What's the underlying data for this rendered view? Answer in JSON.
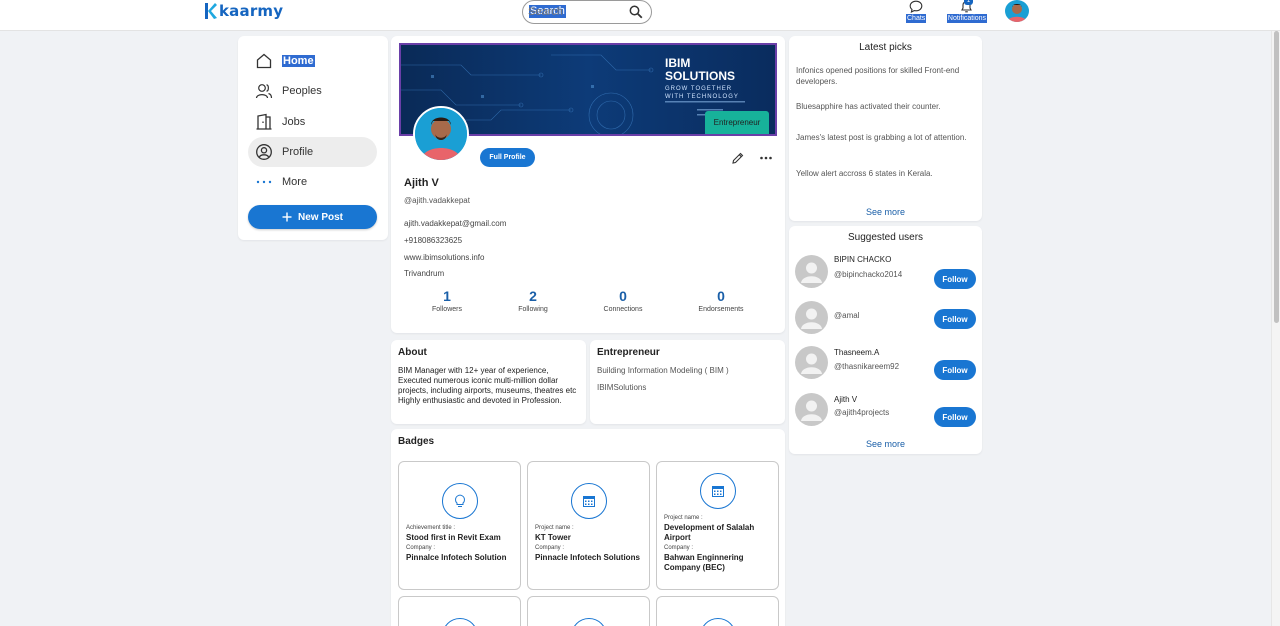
{
  "brand": {
    "name": "kaarmy",
    "accent": "#1976d2"
  },
  "search": {
    "placeholder": "Search"
  },
  "topnav": {
    "chats_label": "Chats",
    "notifications_label": "Notifications",
    "notifications_count": "1"
  },
  "sidebar": {
    "items": [
      {
        "label": "Home",
        "icon": "home-icon"
      },
      {
        "label": "Peoples",
        "icon": "people-icon"
      },
      {
        "label": "Jobs",
        "icon": "jobs-icon"
      },
      {
        "label": "Profile",
        "icon": "profile-icon"
      },
      {
        "label": "More",
        "icon": "more-dots-icon"
      }
    ],
    "new_post_label": "New Post"
  },
  "profile": {
    "banner": {
      "title_line1": "IBIM",
      "title_line2": "SOLUTIONS",
      "tagline1": "GROW TOGETHER",
      "tagline2": "WITH TECHNOLOGY"
    },
    "role_tag": "Entrepreneur",
    "full_profile_label": "Full Profile",
    "name": "Ajith V",
    "handle": "@ajith.vadakkepat",
    "email": "ajith.vadakkepat@gmail.com",
    "phone": "+918086323625",
    "website": "www.ibimsolutions.info",
    "location": "Trivandrum",
    "stats": [
      {
        "value": "1",
        "label": "Followers"
      },
      {
        "value": "2",
        "label": "Following"
      },
      {
        "value": "0",
        "label": "Connections"
      },
      {
        "value": "0",
        "label": "Endorsements"
      }
    ]
  },
  "about": {
    "title": "About",
    "text": "BIM Manager with 12+ year of experience, Executed numerous iconic multi-million dollar projects, including airports, museums, theatres etc Highly enthusiastic and devoted in Profession."
  },
  "entrepreneur": {
    "title": "Entrepreneur",
    "line1": "Building Information Modeling ( BIM )",
    "line2": "IBIMSolutions"
  },
  "badges": {
    "title": "Badges",
    "items": [
      {
        "key1": "Achievement title :",
        "value1": "Stood first in Revit Exam",
        "key2": "Company :",
        "value2": "Pinnalce Infotech Solution",
        "icon": "lightbulb-icon"
      },
      {
        "key1": "Project name :",
        "value1": "KT Tower",
        "key2": "Company :",
        "value2": "Pinnacle Infotech Solutions",
        "icon": "calendar-icon"
      },
      {
        "key1": "Project name :",
        "value1": "Development of Salalah Airport",
        "key2": "Company :",
        "value2": "Bahwan Enginnering Company (BEC)",
        "icon": "calendar-icon"
      }
    ]
  },
  "latest_picks": {
    "title": "Latest picks",
    "items": [
      "Infonics opened positions for skilled Front-end developers.",
      "Bluesapphire has activated their counter.",
      "James's latest post is grabbing a lot of attention.",
      "Yellow alert accross 6 states in Kerala."
    ],
    "see_more": "See more"
  },
  "suggested": {
    "title": "Suggested users",
    "users": [
      {
        "name": "BIPIN CHACKO",
        "handle": "@bipinchacko2014"
      },
      {
        "name": "",
        "handle": "@amal"
      },
      {
        "name": "Thasneem.A",
        "handle": "@thasnikareem92"
      },
      {
        "name": "Ajith V",
        "handle": "@ajith4projects"
      }
    ],
    "follow_label": "Follow",
    "see_more": "See more"
  }
}
